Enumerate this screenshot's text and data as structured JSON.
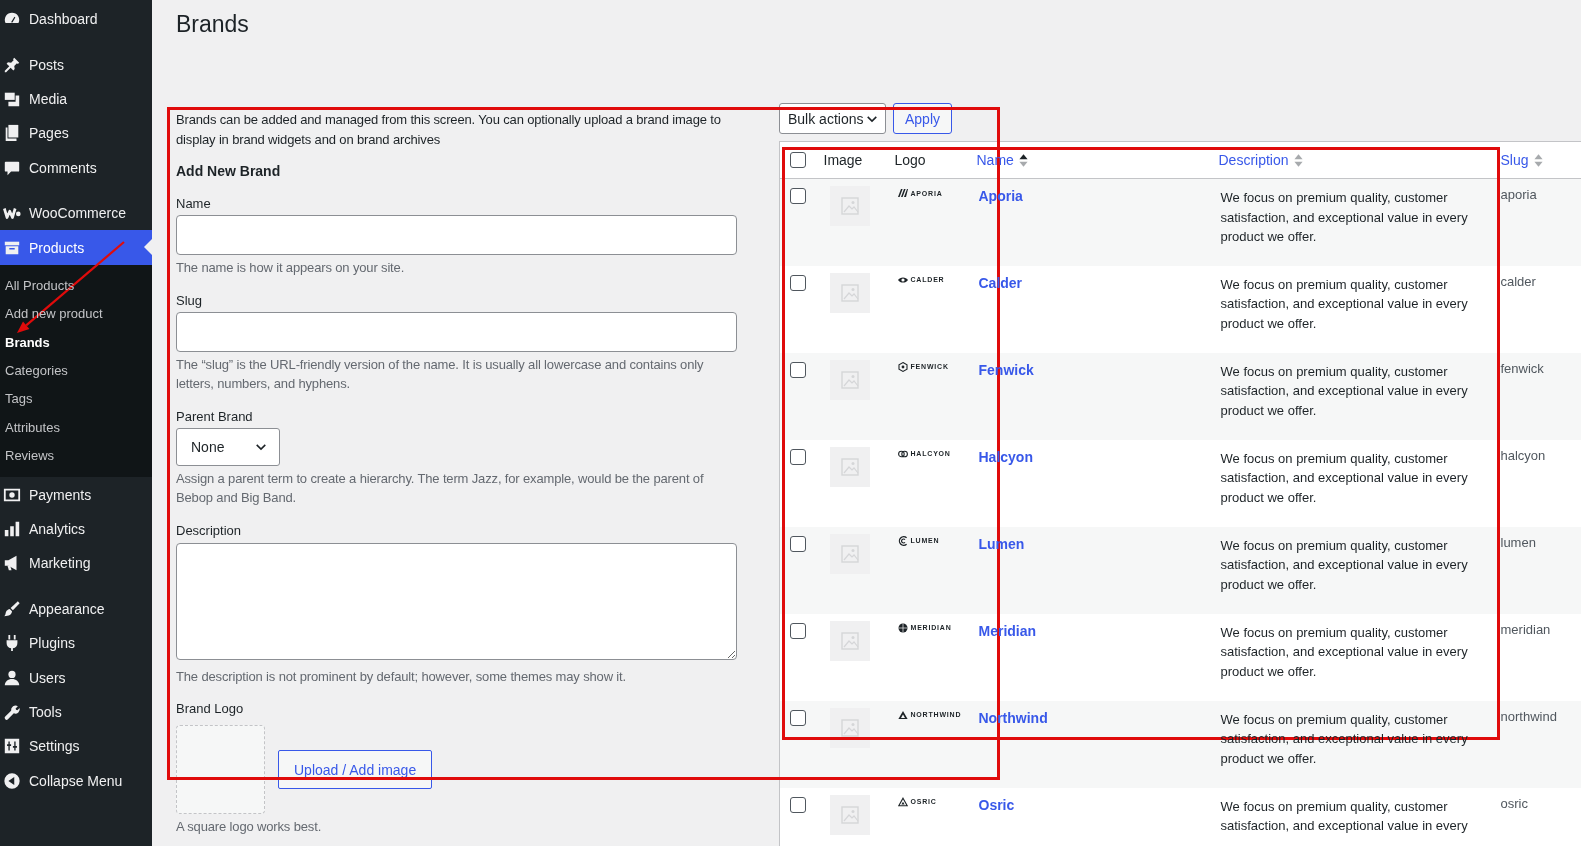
{
  "sidebar": {
    "groups": [
      {
        "items": [
          {
            "label": "Dashboard",
            "selected": false
          }
        ]
      },
      {
        "items": [
          {
            "label": "Posts",
            "selected": false
          },
          {
            "label": "Media",
            "selected": false
          },
          {
            "label": "Pages",
            "selected": false
          },
          {
            "label": "Comments",
            "selected": false
          }
        ]
      },
      {
        "items": [
          {
            "label": "WooCommerce",
            "selected": false
          },
          {
            "label": "Products",
            "selected": true,
            "children": [
              {
                "label": "All Products",
                "selected": false
              },
              {
                "label": "Add new product",
                "selected": false
              },
              {
                "label": "Brands",
                "selected": true
              },
              {
                "label": "Categories",
                "selected": false
              },
              {
                "label": "Tags",
                "selected": false
              },
              {
                "label": "Attributes",
                "selected": false
              },
              {
                "label": "Reviews",
                "selected": false
              }
            ]
          },
          {
            "label": "Payments",
            "selected": false
          },
          {
            "label": "Analytics",
            "selected": false
          },
          {
            "label": "Marketing",
            "selected": false
          }
        ]
      },
      {
        "items": [
          {
            "label": "Appearance",
            "selected": false
          },
          {
            "label": "Plugins",
            "selected": false
          },
          {
            "label": "Users",
            "selected": false
          },
          {
            "label": "Tools",
            "selected": false
          },
          {
            "label": "Settings",
            "selected": false
          },
          {
            "label": "Collapse Menu",
            "selected": false
          }
        ]
      }
    ]
  },
  "page_title": "Brands",
  "form": {
    "intro": "Brands can be added and managed from this screen. You can optionally upload a brand image to display in brand widgets and on brand archives",
    "heading": "Add New Brand",
    "fields": [
      {
        "kind": "text",
        "label": "Name",
        "hint": "The name is how it appears on your site."
      },
      {
        "kind": "text",
        "label": "Slug",
        "hint": "The “slug” is the URL-friendly version of the name. It is usually all lowercase and contains only letters, numbers, and hyphens."
      },
      {
        "kind": "select",
        "label": "Parent Brand",
        "value": "None",
        "hint": "Assign a parent term to create a hierarchy. The term Jazz, for example, would be the parent of Bebop and Big Band."
      },
      {
        "kind": "textarea",
        "label": "Description",
        "hint": "The description is not prominent by default; however, some themes may show it."
      },
      {
        "kind": "image",
        "label": "Brand Logo",
        "button": "Upload / Add image",
        "hint": "A square logo works best."
      }
    ]
  },
  "bulk_actions": {
    "value": "Bulk actions"
  },
  "apply_button": "Apply",
  "table": {
    "select_all": {
      "checked": false
    },
    "columns": [
      {
        "label": "Image"
      },
      {
        "label": "Logo"
      },
      {
        "label": "Name",
        "sorted": true
      },
      {
        "label": "Description",
        "sorted": false
      },
      {
        "label": "Slug",
        "sorted": false
      }
    ],
    "rows": [
      {
        "selected": false,
        "logo": "APORIA",
        "name": "Aporia",
        "description": "We focus on premium quality, customer satisfaction, and exceptional value in every product we offer.",
        "slug": "aporia"
      },
      {
        "selected": false,
        "logo": "CALDER",
        "name": "Calder",
        "description": "We focus on premium quality, customer satisfaction, and exceptional value in every product we offer.",
        "slug": "calder"
      },
      {
        "selected": false,
        "logo": "FENWICK",
        "name": "Fenwick",
        "description": "We focus on premium quality, customer satisfaction, and exceptional value in every product we offer.",
        "slug": "fenwick"
      },
      {
        "selected": false,
        "logo": "HALCYON",
        "name": "Halcyon",
        "description": "We focus on premium quality, customer satisfaction, and exceptional value in every product we offer.",
        "slug": "halcyon"
      },
      {
        "selected": false,
        "logo": "LUMEN",
        "name": "Lumen",
        "description": "We focus on premium quality, customer satisfaction, and exceptional value in every product we offer.",
        "slug": "lumen"
      },
      {
        "selected": false,
        "logo": "MERIDIAN",
        "name": "Meridian",
        "description": "We focus on premium quality, customer satisfaction, and exceptional value in every product we offer.",
        "slug": "meridian"
      },
      {
        "selected": false,
        "logo": "NORTHWIND",
        "name": "Northwind",
        "description": "We focus on premium quality, customer satisfaction, and exceptional value in every product we offer.",
        "slug": "northwind"
      },
      {
        "selected": false,
        "logo": "OSRIC",
        "name": "Osric",
        "description": "We focus on premium quality, customer satisfaction, and exceptional value in every",
        "slug": "osric"
      }
    ]
  },
  "annotations": [
    {
      "kind": "rectangle"
    },
    {
      "kind": "rectangle"
    },
    {
      "kind": "arrow"
    }
  ]
}
